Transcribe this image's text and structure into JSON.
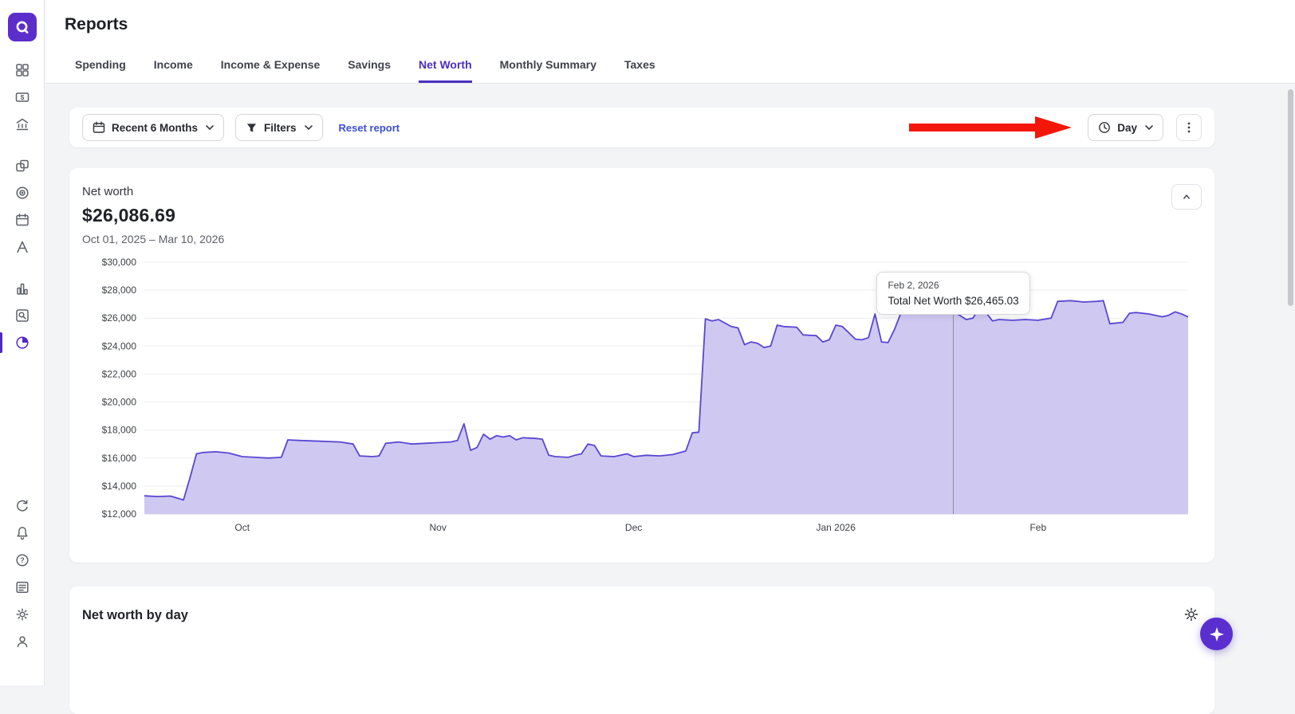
{
  "header": {
    "title": "Reports"
  },
  "tabs": [
    {
      "label": "Spending",
      "active": false
    },
    {
      "label": "Income",
      "active": false
    },
    {
      "label": "Income & Expense",
      "active": false
    },
    {
      "label": "Savings",
      "active": false
    },
    {
      "label": "Net Worth",
      "active": true
    },
    {
      "label": "Monthly Summary",
      "active": false
    },
    {
      "label": "Taxes",
      "active": false
    }
  ],
  "toolbar": {
    "date_range_label": "Recent 6 Months",
    "filters_label": "Filters",
    "reset_label": "Reset report",
    "interval_label": "Day"
  },
  "net_worth_card": {
    "title": "Net worth",
    "amount": "$26,086.69",
    "date_range": "Oct 01, 2025 – Mar 10, 2026"
  },
  "tooltip": {
    "date": "Feb 2, 2026",
    "label": "Total Net Worth",
    "value": "$26,465.03"
  },
  "bottom_card": {
    "title": "Net worth by day"
  },
  "sidebar": {
    "items": [
      "dashboard-icon",
      "cash-icon",
      "bank-icon",
      "connections-icon",
      "goals-icon",
      "calendar-icon",
      "planning-icon",
      "bar-chart-icon",
      "search-report-icon",
      "pie-chart-icon"
    ],
    "bottom_items": [
      "sync-icon",
      "bell-icon",
      "help-icon",
      "feed-icon",
      "gear-icon",
      "profile-icon"
    ],
    "active_item": "pie-chart-icon"
  },
  "annotation": {
    "type": "red-arrow",
    "points_to": "interval-button",
    "color": "#f3170a"
  },
  "colors": {
    "accent_purple": "#5b2ecc",
    "tab_active": "#4b2fc0",
    "link_blue": "#3b4ed8",
    "chart_line": "#5847d2",
    "chart_fill": "#cfc9f2"
  },
  "chart_data": {
    "type": "area",
    "title": "Net worth",
    "subtitle": "Oct 01, 2025 – Mar 10, 2026",
    "x_unit": "day index from Oct 1, 2025",
    "x_domain_days": [
      0,
      160
    ],
    "ylim": [
      12000,
      30000
    ],
    "grid": true,
    "legend": false,
    "line_color": "#5847d2",
    "fill_color": "#cfc9f2",
    "y_ticks": [
      {
        "value": 30000,
        "label": "$30,000"
      },
      {
        "value": 28000,
        "label": "$28,000"
      },
      {
        "value": 26000,
        "label": "$26,000"
      },
      {
        "value": 24000,
        "label": "$24,000"
      },
      {
        "value": 22000,
        "label": "$22,000"
      },
      {
        "value": 20000,
        "label": "$20,000"
      },
      {
        "value": 18000,
        "label": "$18,000"
      },
      {
        "value": 16000,
        "label": "$16,000"
      },
      {
        "value": 14000,
        "label": "$14,000"
      },
      {
        "value": 12000,
        "label": "$12,000"
      }
    ],
    "x_ticks": [
      {
        "day": 15,
        "label": "Oct"
      },
      {
        "day": 45,
        "label": "Nov"
      },
      {
        "day": 75,
        "label": "Dec"
      },
      {
        "day": 106,
        "label": "Jan 2026"
      },
      {
        "day": 137,
        "label": "Feb"
      }
    ],
    "cursor": {
      "day": 124,
      "date": "Feb 2, 2026",
      "value": 26465.03
    },
    "series": [
      {
        "name": "Total Net Worth",
        "points": [
          [
            0,
            13300
          ],
          [
            2,
            13250
          ],
          [
            4,
            13280
          ],
          [
            6,
            13000
          ],
          [
            7,
            14600
          ],
          [
            8,
            16300
          ],
          [
            9,
            16400
          ],
          [
            11,
            16450
          ],
          [
            13,
            16350
          ],
          [
            15,
            16100
          ],
          [
            17,
            16050
          ],
          [
            19,
            16000
          ],
          [
            21,
            16050
          ],
          [
            22,
            17300
          ],
          [
            24,
            17250
          ],
          [
            27,
            17200
          ],
          [
            30,
            17150
          ],
          [
            32,
            17000
          ],
          [
            33,
            16150
          ],
          [
            35,
            16100
          ],
          [
            36,
            16150
          ],
          [
            37,
            17050
          ],
          [
            39,
            17150
          ],
          [
            41,
            17000
          ],
          [
            43,
            17050
          ],
          [
            45,
            17100
          ],
          [
            47,
            17150
          ],
          [
            48,
            17250
          ],
          [
            49,
            18450
          ],
          [
            50,
            16550
          ],
          [
            51,
            16750
          ],
          [
            52,
            17700
          ],
          [
            53,
            17350
          ],
          [
            54,
            17600
          ],
          [
            55,
            17500
          ],
          [
            56,
            17600
          ],
          [
            57,
            17300
          ],
          [
            58,
            17450
          ],
          [
            60,
            17400
          ],
          [
            61,
            17350
          ],
          [
            62,
            16200
          ],
          [
            63,
            16100
          ],
          [
            65,
            16050
          ],
          [
            66,
            16200
          ],
          [
            67,
            16300
          ],
          [
            68,
            17000
          ],
          [
            69,
            16900
          ],
          [
            70,
            16150
          ],
          [
            72,
            16100
          ],
          [
            74,
            16300
          ],
          [
            75,
            16100
          ],
          [
            77,
            16200
          ],
          [
            79,
            16150
          ],
          [
            81,
            16250
          ],
          [
            83,
            16500
          ],
          [
            84,
            17800
          ],
          [
            85,
            17850
          ],
          [
            86,
            25950
          ],
          [
            87,
            25800
          ],
          [
            88,
            25900
          ],
          [
            90,
            25400
          ],
          [
            91,
            25300
          ],
          [
            92,
            24100
          ],
          [
            93,
            24300
          ],
          [
            94,
            24200
          ],
          [
            95,
            23900
          ],
          [
            96,
            24000
          ],
          [
            97,
            25500
          ],
          [
            98,
            25400
          ],
          [
            100,
            25350
          ],
          [
            101,
            24800
          ],
          [
            103,
            24750
          ],
          [
            104,
            24300
          ],
          [
            105,
            24450
          ],
          [
            106,
            25500
          ],
          [
            107,
            25400
          ],
          [
            109,
            24500
          ],
          [
            110,
            24450
          ],
          [
            111,
            24600
          ],
          [
            112,
            26300
          ],
          [
            113,
            24300
          ],
          [
            114,
            24250
          ],
          [
            115,
            25200
          ],
          [
            116,
            26400
          ],
          [
            118,
            26450
          ],
          [
            120,
            26300
          ],
          [
            122,
            26350
          ],
          [
            124,
            26465.03
          ],
          [
            125,
            26200
          ],
          [
            126,
            25900
          ],
          [
            127,
            26000
          ],
          [
            128,
            26700
          ],
          [
            129,
            26400
          ],
          [
            130,
            25800
          ],
          [
            131,
            25900
          ],
          [
            133,
            25850
          ],
          [
            135,
            25900
          ],
          [
            137,
            25850
          ],
          [
            139,
            26000
          ],
          [
            140,
            27200
          ],
          [
            142,
            27250
          ],
          [
            144,
            27150
          ],
          [
            146,
            27200
          ],
          [
            147,
            27250
          ],
          [
            148,
            25600
          ],
          [
            150,
            25700
          ],
          [
            151,
            26350
          ],
          [
            152,
            26400
          ],
          [
            154,
            26300
          ],
          [
            156,
            26100
          ],
          [
            157,
            26200
          ],
          [
            158,
            26450
          ],
          [
            159,
            26300
          ],
          [
            160,
            26086.69
          ]
        ]
      }
    ]
  }
}
